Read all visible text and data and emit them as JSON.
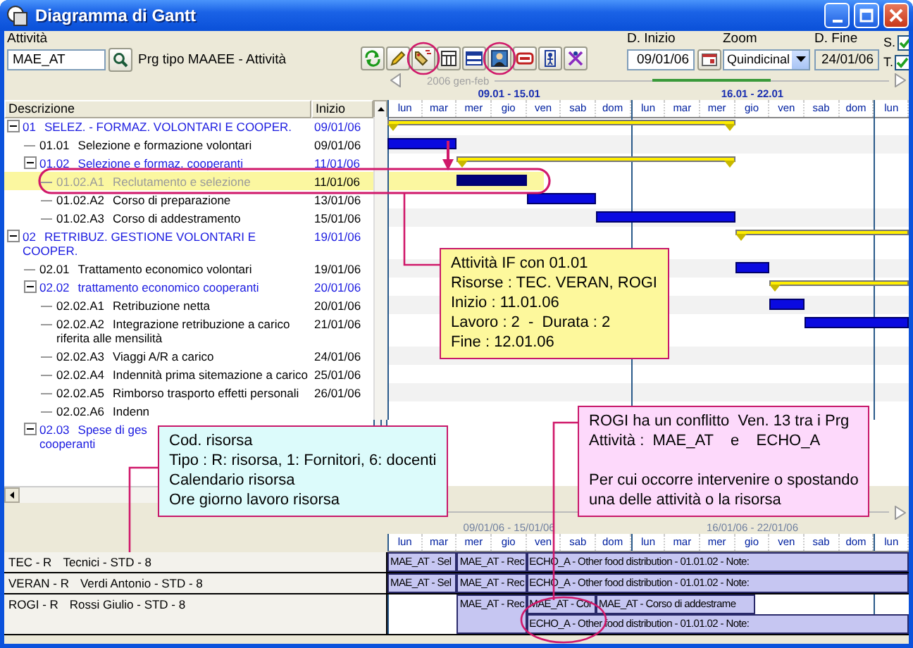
{
  "window": {
    "title": "Diagramma di Gantt"
  },
  "toolbar": {
    "activity_label": "Attività",
    "activity_value": "MAE_AT",
    "project_name": "Prg tipo MAAEE - Attività",
    "start_label": "D. Inizio",
    "start_value": "09/01/06",
    "zoom_label": "Zoom",
    "zoom_value": "Quindicinal",
    "end_label": "D. Fine",
    "end_value": "24/01/06",
    "checks": [
      {
        "label": "S.",
        "checked": true
      },
      {
        "label": "T.",
        "checked": true
      }
    ]
  },
  "timeline": {
    "period": "2006 gen-feb",
    "weeks": [
      "09.01 - 15.01",
      "16.01 - 22.01"
    ],
    "days": [
      "lun",
      "mar",
      "mer",
      "gio",
      "ven",
      "sab",
      "dom",
      "lun",
      "mar",
      "mer",
      "gio",
      "ven",
      "sab",
      "dom",
      "lun"
    ]
  },
  "table": {
    "columns": [
      "Descrizione",
      "Inizio"
    ],
    "rows": [
      {
        "code": "01",
        "name": "SELEZ. - FORMAZ. VOLONTARI E COOPER.",
        "start": "09/01/06",
        "kind": "summary",
        "expanded": true,
        "selected": false,
        "children": [
          {
            "code": "01.01",
            "name": "Selezione e formazione volontari",
            "start": "09/01/06",
            "kind": "task",
            "selected": false
          },
          {
            "code": "01.02",
            "name": "Selezione e formaz. cooperanti",
            "start": "11/01/06",
            "kind": "summary",
            "expanded": true,
            "selected": false,
            "children": [
              {
                "code": "01.02.A1",
                "name": "Reclutamento e selezione",
                "start": "11/01/06",
                "kind": "task",
                "selected": true
              },
              {
                "code": "01.02.A2",
                "name": "Corso di preparazione",
                "start": "13/01/06",
                "kind": "task",
                "selected": false
              },
              {
                "code": "01.02.A3",
                "name": "Corso di addestramento",
                "start": "15/01/06",
                "kind": "task",
                "selected": false
              }
            ]
          }
        ]
      },
      {
        "code": "02",
        "name": "RETRIBUZ. GESTIONE VOLONTARI E COOPER.",
        "start": "19/01/06",
        "kind": "summary",
        "expanded": true,
        "selected": false,
        "children": [
          {
            "code": "02.01",
            "name": "Trattamento economico volontari",
            "start": "19/01/06",
            "kind": "task",
            "selected": false
          },
          {
            "code": "02.02",
            "name": "trattamento economico cooperanti",
            "start": "20/01/06",
            "kind": "summary",
            "expanded": true,
            "selected": false,
            "children": [
              {
                "code": "02.02.A1",
                "name": "Retribuzione netta",
                "start": "20/01/06",
                "kind": "task",
                "selected": false
              },
              {
                "code": "02.02.A2",
                "name": "Integrazione retribuzione a carico riferita alle mensilità",
                "start": "21/01/06",
                "kind": "task",
                "selected": false
              },
              {
                "code": "02.02.A3",
                "name": "Viaggi A/R a carico",
                "start": "24/01/06",
                "kind": "task",
                "selected": false
              },
              {
                "code": "02.02.A4",
                "name": "Indennità prima sitemazione a carico",
                "start": "25/01/06",
                "kind": "task",
                "selected": false
              },
              {
                "code": "02.02.A5",
                "name": "Rimborso trasporto effetti personali",
                "start": "26/01/06",
                "kind": "task",
                "selected": false
              },
              {
                "code": "02.02.A6",
                "name": "Indenn",
                "kind": "task",
                "selected": false
              }
            ]
          },
          {
            "code": "02.03",
            "name": "Spese di ges",
            "continued": "cooperanti",
            "kind": "summary",
            "expanded": true,
            "selected": false
          }
        ]
      }
    ]
  },
  "resources": {
    "weeks": [
      "09/01/06 - 15/01/06",
      "16/01/06 - 22/01/06"
    ],
    "days": [
      "lun",
      "mar",
      "mer",
      "gio",
      "ven",
      "sab",
      "dom",
      "lun",
      "mar",
      "mer",
      "gio",
      "ven",
      "sab",
      "dom",
      "lun"
    ],
    "rows": [
      {
        "code": "TEC - R",
        "name": "Tecnici - STD - 8",
        "bars": [
          "MAE_AT - Sel",
          "MAE_AT - Rec",
          "ECHO_A - Other food distribution - 01.01.02 - Note:"
        ]
      },
      {
        "code": "VERAN - R",
        "name": "Verdi Antonio - STD - 8",
        "bars": [
          "MAE_AT - Sel",
          "MAE_AT - Rec",
          "ECHO_A - Other food distribution - 01.01.02 - Note:"
        ]
      },
      {
        "code": "ROGI - R",
        "name": "Rossi Giulio - STD - 8",
        "bars": [
          "MAE_AT - Rec",
          "MAE_AT - Cor",
          "MAE_AT - Corso di addestrame",
          "ECHO_A - Other food distribution - 01.01.02 - Note:"
        ]
      }
    ]
  },
  "notes": [
    {
      "color": "#fdf89c",
      "paragraphs": [
        [
          "Attività IF con 01.01",
          "Risorse : TEC. VERAN, ROGI",
          "Inizio : 11.01.06",
          "Lavoro : 2  -  Durata : 2",
          "Fine : 12.01.06"
        ]
      ]
    },
    {
      "color": "#dcfbfb",
      "paragraphs": [
        [
          "Cod. risorsa",
          "Tipo : R: risorsa, 1: Fornitori, 6: docenti",
          "Calendario risorsa",
          "Ore giorno lavoro risorsa"
        ]
      ]
    },
    {
      "color": "#fdd9fb",
      "paragraphs": [
        [
          "ROGI ha un conflitto  Ven. 13 tra i Prg",
          "Attività :  MAE_AT    e    ECHO_A"
        ],
        [
          "Per cui occorre intervenire o spostando",
          "una delle attività o la risorsa"
        ]
      ]
    }
  ]
}
